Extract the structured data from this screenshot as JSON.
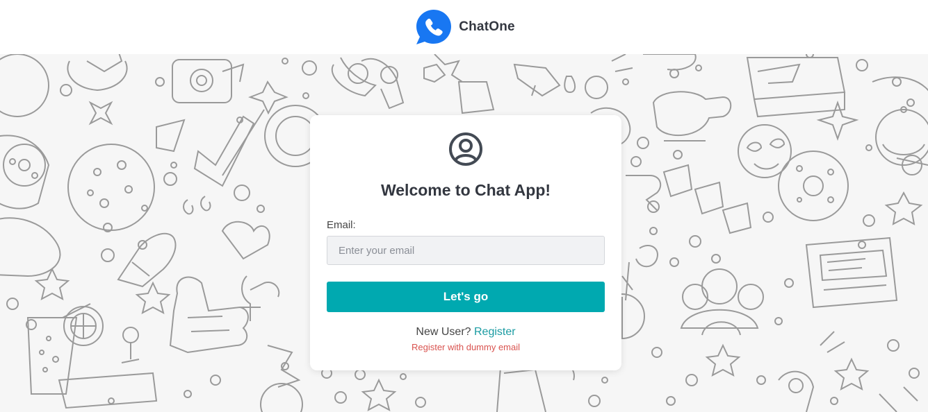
{
  "header": {
    "brand_name": "ChatOne",
    "logo_icon": "phone-chat-bubble-icon",
    "logo_color": "#1877f2"
  },
  "login_card": {
    "avatar_icon": "user-circle-icon",
    "title": "Welcome to Chat App!",
    "email_label": "Email:",
    "email_placeholder": "Enter your email",
    "email_value": "",
    "submit_label": "Let's go",
    "new_user_text": "New User?",
    "register_link": "Register",
    "dummy_link": "Register with dummy email"
  },
  "colors": {
    "accent": "#00a9b0",
    "link": "#1a9ba2",
    "danger": "#d9534f",
    "title": "#333740",
    "background_pattern": "#f6f6f6"
  }
}
